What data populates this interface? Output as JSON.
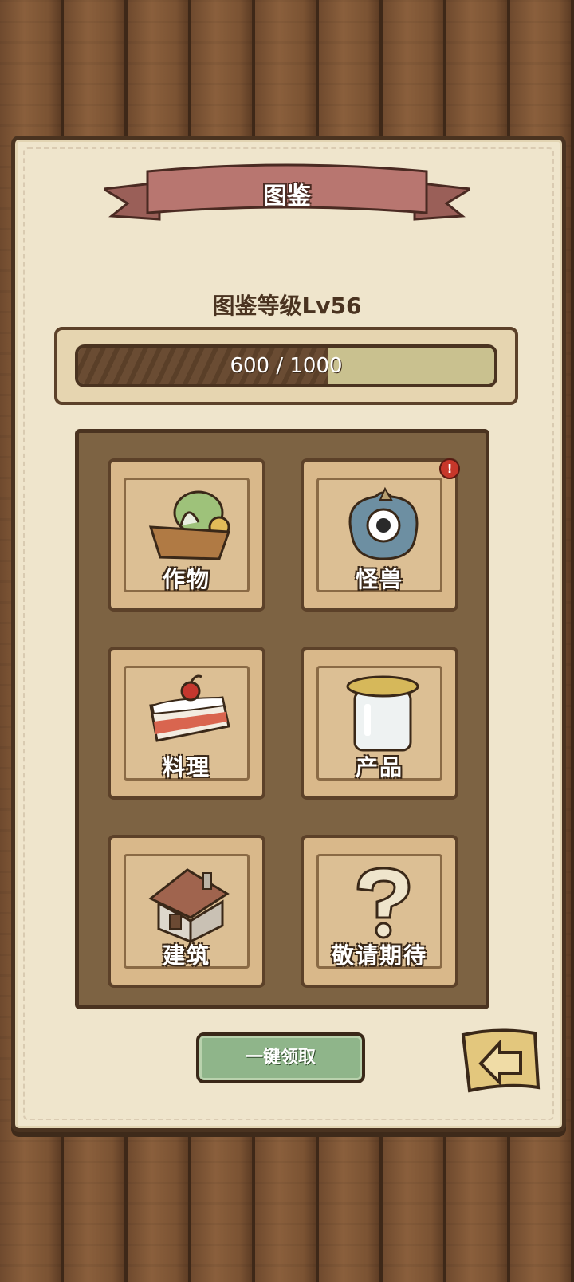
{
  "header": {
    "title": "图鉴"
  },
  "level": {
    "label": "图鉴等级Lv56",
    "progress_text": "600 / 1000",
    "current": 600,
    "max": 1000
  },
  "categories": [
    {
      "label": "作物",
      "icon": "vegetable-basket-icon",
      "alert": false
    },
    {
      "label": "怪兽",
      "icon": "monster-icon",
      "alert": true,
      "alert_symbol": "!"
    },
    {
      "label": "料理",
      "icon": "cake-icon",
      "alert": false
    },
    {
      "label": "产品",
      "icon": "jar-icon",
      "alert": false
    },
    {
      "label": "建筑",
      "icon": "house-icon",
      "alert": false
    },
    {
      "label": "敬请期待",
      "icon": "question-mark-icon",
      "alert": false
    }
  ],
  "actions": {
    "claim_all": "一键领取",
    "back_icon": "back-arrow-icon"
  },
  "colors": {
    "paper": "#efe5cc",
    "wood": "#7d6343",
    "ribbon": "#b87670",
    "button": "#8fb58a"
  }
}
